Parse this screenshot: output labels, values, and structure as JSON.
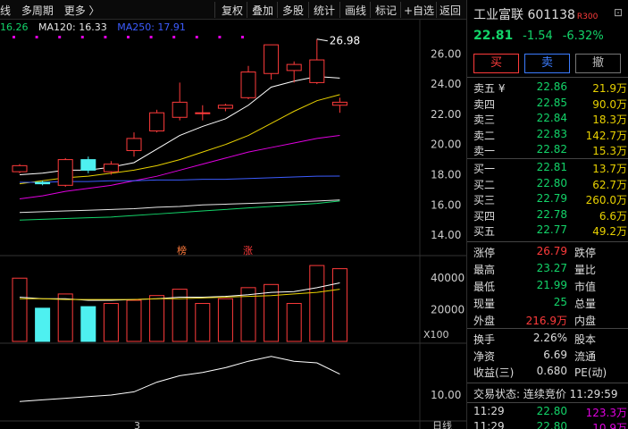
{
  "toolbar": {
    "left_items": [
      "线",
      "多周期",
      "更多 〉"
    ],
    "buttons": [
      "复权",
      "叠加",
      "多股",
      "统计",
      "画线",
      "标记",
      "+自选",
      "返回"
    ]
  },
  "ma_legend": {
    "items": [
      {
        "text": "16.26",
        "color": "#13d469"
      },
      {
        "text": "MA120: 16.33",
        "color": "#e6e6e6"
      },
      {
        "text": "MA250: 17.91",
        "color": "#3c5cff"
      }
    ]
  },
  "price_axis": [
    "26.00",
    "24.00",
    "22.00",
    "20.00",
    "18.00",
    "16.00",
    "14.00"
  ],
  "volume_axis": [
    "40000",
    "20000"
  ],
  "volume_unit": "X100",
  "indicator_axis": [
    "10.00"
  ],
  "bottom_axis": {
    "left_tick": "3",
    "right_label": "日线"
  },
  "chart_tags": {
    "bang": "榜",
    "zhang": "涨"
  },
  "max_label": "26.98",
  "chart_data": {
    "type": "candlestick",
    "candles": [
      {
        "o": 18.2,
        "c": 18.6,
        "h": 18.7,
        "l": 18.1
      },
      {
        "o": 17.5,
        "c": 17.4,
        "h": 17.6,
        "l": 17.3
      },
      {
        "o": 17.3,
        "c": 19.0,
        "h": 19.1,
        "l": 17.2
      },
      {
        "o": 19.0,
        "c": 18.3,
        "h": 19.2,
        "l": 18.1
      },
      {
        "o": 18.2,
        "c": 18.7,
        "h": 18.9,
        "l": 18.0
      },
      {
        "o": 19.6,
        "c": 20.4,
        "h": 20.8,
        "l": 19.2
      },
      {
        "o": 20.9,
        "c": 22.1,
        "h": 22.3,
        "l": 20.8
      },
      {
        "o": 21.8,
        "c": 22.8,
        "h": 24.1,
        "l": 21.6
      },
      {
        "o": 22.1,
        "c": 22.1,
        "h": 22.6,
        "l": 21.6
      },
      {
        "o": 22.4,
        "c": 22.6,
        "h": 22.7,
        "l": 22.2
      },
      {
        "o": 23.1,
        "c": 24.8,
        "h": 25.2,
        "l": 23.0
      },
      {
        "o": 24.7,
        "c": 26.6,
        "h": 26.6,
        "l": 24.3
      },
      {
        "o": 24.9,
        "c": 25.3,
        "h": 25.5,
        "l": 24.1
      },
      {
        "o": 24.1,
        "c": 25.6,
        "h": 26.98,
        "l": 24.0
      },
      {
        "o": 22.6,
        "c": 22.8,
        "h": 23.1,
        "l": 22.1
      }
    ],
    "volumes": [
      40000,
      21000,
      30000,
      22000,
      24000,
      26000,
      29000,
      33000,
      24000,
      27000,
      34000,
      36000,
      24000,
      48000,
      46000
    ],
    "ma_lines": [
      {
        "name": "MA5",
        "color": "#ffffff",
        "values": [
          18.0,
          18.1,
          18.3,
          18.3,
          18.5,
          18.8,
          19.7,
          20.6,
          21.2,
          21.7,
          22.6,
          23.8,
          24.2,
          24.5,
          24.4
        ]
      },
      {
        "name": "MA10",
        "color": "#e8d100",
        "values": [
          17.4,
          17.6,
          17.8,
          17.9,
          18.1,
          18.3,
          18.6,
          19.0,
          19.5,
          20.0,
          20.6,
          21.4,
          22.2,
          22.9,
          23.3
        ]
      },
      {
        "name": "MA20",
        "color": "#e000e0",
        "values": [
          16.4,
          16.6,
          16.9,
          17.1,
          17.3,
          17.6,
          17.9,
          18.3,
          18.7,
          19.1,
          19.5,
          19.8,
          20.1,
          20.4,
          20.6
        ]
      },
      {
        "name": "MA250",
        "color": "#3c5cff",
        "values": [
          17.5,
          17.5,
          17.55,
          17.55,
          17.6,
          17.6,
          17.65,
          17.65,
          17.7,
          17.7,
          17.75,
          17.8,
          17.85,
          17.9,
          17.91
        ]
      },
      {
        "name": "MA120",
        "color": "#e6e6e6",
        "values": [
          15.5,
          15.55,
          15.6,
          15.65,
          15.7,
          15.75,
          15.85,
          15.9,
          16.0,
          16.05,
          16.1,
          16.15,
          16.2,
          16.26,
          16.33
        ]
      },
      {
        "name": "",
        "color": "#13d469",
        "values": [
          15.0,
          15.05,
          15.1,
          15.15,
          15.2,
          15.3,
          15.4,
          15.5,
          15.6,
          15.7,
          15.8,
          15.9,
          16.0,
          16.1,
          16.26
        ]
      }
    ],
    "indicator": [
      9.6,
      9.7,
      9.8,
      9.9,
      10.0,
      10.2,
      10.8,
      11.2,
      11.4,
      11.7,
      12.1,
      12.4,
      12.1,
      12.0,
      11.3
    ]
  },
  "quote": {
    "name": "工业富联",
    "code": "601138",
    "tag": "R300",
    "price": "22.81",
    "change": "-1.54",
    "change_pct": "-6.32%",
    "buttons": [
      {
        "label": "买",
        "color": "#ff3b3b"
      },
      {
        "label": "卖",
        "color": "#3c7cff"
      },
      {
        "label": "撤",
        "color": "#bbbbbb"
      }
    ],
    "asks": [
      {
        "label": "卖五 ¥",
        "price": "22.86",
        "vol": "21.9万"
      },
      {
        "label": "卖四",
        "price": "22.85",
        "vol": "90.0万"
      },
      {
        "label": "卖三",
        "price": "22.84",
        "vol": "18.3万"
      },
      {
        "label": "卖二",
        "price": "22.83",
        "vol": "142.7万"
      },
      {
        "label": "卖一",
        "price": "22.82",
        "vol": "15.3万"
      }
    ],
    "bids": [
      {
        "label": "买一",
        "price": "22.81",
        "vol": "13.7万"
      },
      {
        "label": "买二",
        "price": "22.80",
        "vol": "62.7万"
      },
      {
        "label": "买三",
        "price": "22.79",
        "vol": "260.0万"
      },
      {
        "label": "买四",
        "price": "22.78",
        "vol": "6.6万"
      },
      {
        "label": "买五",
        "price": "22.77",
        "vol": "49.2万"
      }
    ],
    "stats1": [
      {
        "l1": "涨停",
        "v1": "26.79",
        "c1": "#ff3b3b",
        "l2": "跌停"
      },
      {
        "l1": "最高",
        "v1": "23.27",
        "c1": "#13d469",
        "l2": "量比"
      },
      {
        "l1": "最低",
        "v1": "21.99",
        "c1": "#13d469",
        "l2": "市值"
      },
      {
        "l1": "现量",
        "v1": "25",
        "c1": "#13d469",
        "l2": "总量"
      },
      {
        "l1": "外盘",
        "v1": "216.9万",
        "c1": "#ff3b3b",
        "l2": "内盘"
      }
    ],
    "stats2": [
      {
        "l1": "换手",
        "v1": "2.26%",
        "l2": "股本"
      },
      {
        "l1": "净资",
        "v1": "6.69",
        "l2": "流通"
      },
      {
        "l1": "收益(三)",
        "v1": "0.680",
        "l2": "PE(动)"
      }
    ],
    "trade_status": "交易状态: 连续竞价 11:29:59",
    "ticks": [
      {
        "time": "11:29",
        "price": "22.80",
        "vol": "123.3万"
      },
      {
        "time": "11:29",
        "price": "22.80",
        "vol": "10.9万"
      }
    ]
  }
}
